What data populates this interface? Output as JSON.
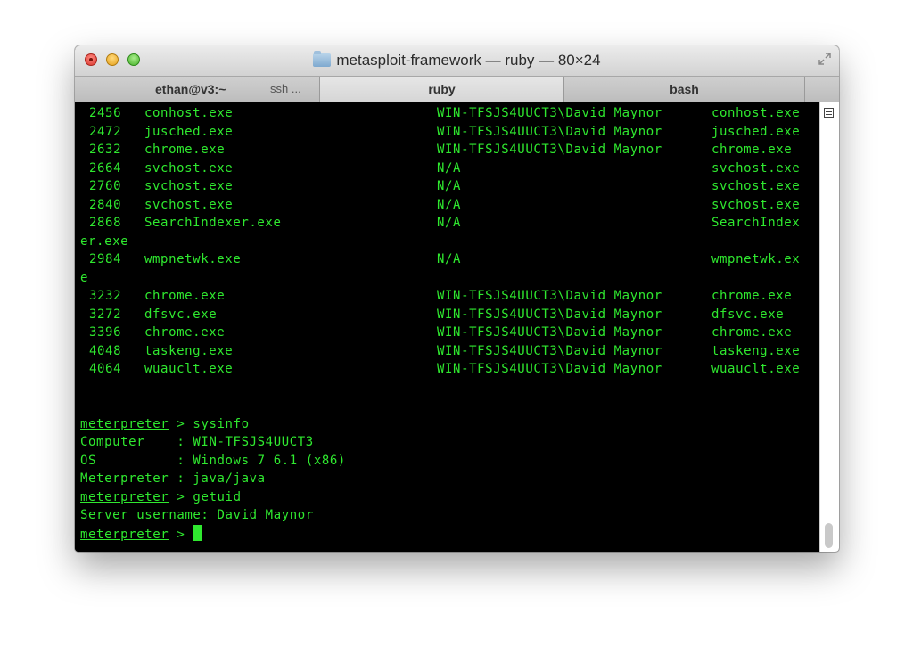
{
  "window": {
    "title": "metasploit-framework — ruby — 80×24",
    "tabs": [
      {
        "label": "ethan@v3:~",
        "process": "ssh ..."
      },
      {
        "label": "ruby"
      },
      {
        "label": "bash"
      }
    ]
  },
  "terminal": {
    "processes": [
      {
        "pid": "2456",
        "name": "conhost.exe",
        "user": "WIN-TFSJS4UUCT3\\David Maynor",
        "path": "conhost.exe"
      },
      {
        "pid": "2472",
        "name": "jusched.exe",
        "user": "WIN-TFSJS4UUCT3\\David Maynor",
        "path": "jusched.exe"
      },
      {
        "pid": "2632",
        "name": "chrome.exe",
        "user": "WIN-TFSJS4UUCT3\\David Maynor",
        "path": "chrome.exe"
      },
      {
        "pid": "2664",
        "name": "svchost.exe",
        "user": "N/A",
        "path": "svchost.exe"
      },
      {
        "pid": "2760",
        "name": "svchost.exe",
        "user": "N/A",
        "path": "svchost.exe"
      },
      {
        "pid": "2840",
        "name": "svchost.exe",
        "user": "N/A",
        "path": "svchost.exe"
      },
      {
        "pid": "2868",
        "name": "SearchIndexer.exe",
        "user": "N/A",
        "path": "SearchIndex",
        "wrap": "er.exe"
      },
      {
        "pid": "2984",
        "name": "wmpnetwk.exe",
        "user": "N/A",
        "path": "wmpnetwk.ex",
        "wrap": "e"
      },
      {
        "pid": "3232",
        "name": "chrome.exe",
        "user": "WIN-TFSJS4UUCT3\\David Maynor",
        "path": "chrome.exe"
      },
      {
        "pid": "3272",
        "name": "dfsvc.exe",
        "user": "WIN-TFSJS4UUCT3\\David Maynor",
        "path": "dfsvc.exe"
      },
      {
        "pid": "3396",
        "name": "chrome.exe",
        "user": "WIN-TFSJS4UUCT3\\David Maynor",
        "path": "chrome.exe"
      },
      {
        "pid": "4048",
        "name": "taskeng.exe",
        "user": "WIN-TFSJS4UUCT3\\David Maynor",
        "path": "taskeng.exe"
      },
      {
        "pid": "4064",
        "name": "wuauclt.exe",
        "user": "WIN-TFSJS4UUCT3\\David Maynor",
        "path": "wuauclt.exe"
      }
    ],
    "prompt_word": "meterpreter",
    "prompt_sep": " > ",
    "cmd_sysinfo": "sysinfo",
    "sysinfo": [
      "Computer    : WIN-TFSJS4UUCT3",
      "OS          : Windows 7 6.1 (x86)",
      "Meterpreter : java/java"
    ],
    "cmd_getuid": "getuid",
    "server_username": "Server username: David Maynor"
  },
  "colors": {
    "terminal_text": "#2fe82f",
    "terminal_bg": "#000000"
  }
}
